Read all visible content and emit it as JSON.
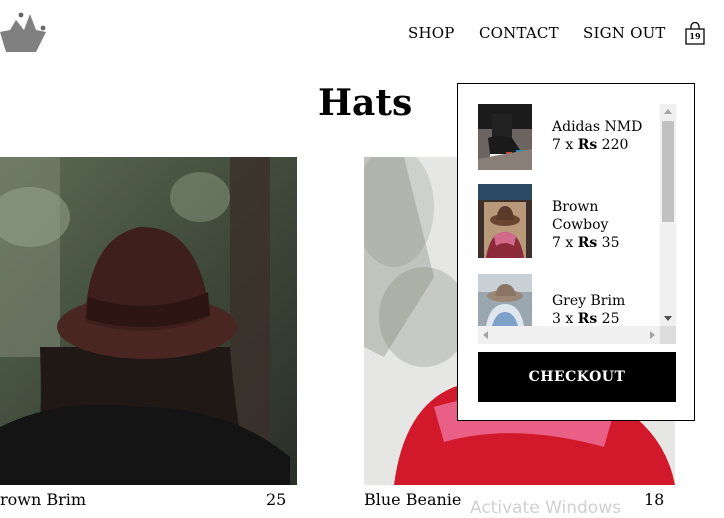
{
  "header": {
    "logo_icon": "crown-icon",
    "nav": [
      {
        "label": "SHOP"
      },
      {
        "label": "CONTACT"
      },
      {
        "label": "SIGN OUT"
      }
    ],
    "cart_icon": "shopping-bag-icon",
    "cart_count": "19"
  },
  "page": {
    "title": "Hats"
  },
  "products": [
    {
      "name": "rown Brim",
      "price": "25"
    },
    {
      "name": "Blue Beanie",
      "price": "18"
    }
  ],
  "cart": {
    "items": [
      {
        "name": "Adidas NMD",
        "qty_prefix": "7 x ",
        "currency": "Rs",
        "price": " 220"
      },
      {
        "name": "Brown Cowboy",
        "qty_prefix": "7 x ",
        "currency": "Rs",
        "price": " 35"
      },
      {
        "name": "Grey Brim",
        "qty_prefix": "3 x ",
        "currency": "Rs",
        "price": " 25"
      }
    ],
    "checkout_label": "CHECKOUT"
  },
  "system": {
    "watermark": "Activate Windows"
  }
}
